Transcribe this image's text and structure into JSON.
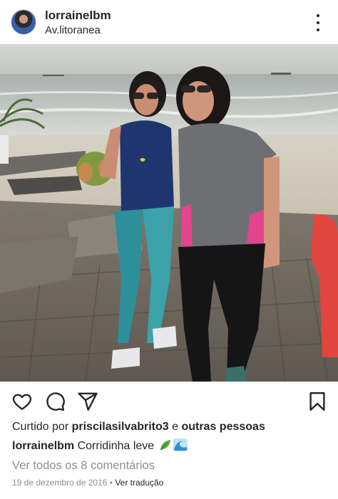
{
  "header": {
    "username": "lorrainelbm",
    "location": "Av.litoranea"
  },
  "photo": {
    "description_icon": "photo-two-women-beach"
  },
  "actions": {
    "like_icon": "heart-icon",
    "comment_icon": "comment-icon",
    "share_icon": "send-icon",
    "save_icon": "bookmark-icon"
  },
  "likes": {
    "prefix": "Curtido por ",
    "user": "priscilasilvabrito3",
    "connector": " e ",
    "others": "outras pessoas"
  },
  "caption": {
    "username": "lorrainelbm",
    "text": " Corridinha leve",
    "emojis": [
      "leaf",
      "wave"
    ]
  },
  "comments": {
    "link": "Ver todos os 8 comentários"
  },
  "meta": {
    "date": "19 de dezembro de 2016",
    "separator": " • ",
    "translate": "Ver tradução"
  }
}
